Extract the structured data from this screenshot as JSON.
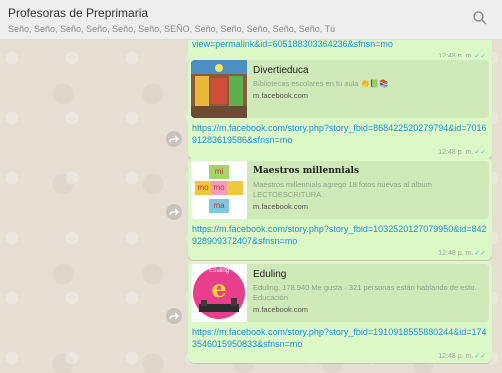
{
  "header": {
    "title": "Profesoras de Preprimaria",
    "members": "Seño, Seño, Seño, Seño, Seño, Seño, SEÑO, Seño, Seño, Seño, Seño, Seño, Tú"
  },
  "messages": [
    {
      "link": "view=permalink&id=605188303364236&sfnsn=mo",
      "time": "12:48 p. m."
    },
    {
      "preview_title": "Divertieduca",
      "preview_desc": "Bibliotecas escolares en tu aula 👏📗📚",
      "preview_domain": "m.facebook.com",
      "link": "https://m.facebook.com/story.php?story_fbid=868422520279794&id=701691283619586&sfnsn=mo",
      "time": "12:48 p. m."
    },
    {
      "preview_title": "Maestros millennials",
      "preview_desc": "Maestros millennials agregó 18 fotos nuevas al álbum LECTOESCRITURA.",
      "preview_domain": "m.facebook.com",
      "link": "https://m.facebook.com/story.php?story_fbid=1032520127079950&id=842928909372407&sfnsn=mo",
      "time": "12:48 p. m."
    },
    {
      "preview_title": "Eduling",
      "preview_desc": "Eduling. 178.940 Me gusta · 321 personas están hablando de esto. Educación",
      "preview_domain": "m.facebook.com",
      "link": "https://m.facebook.com/story.php?story_fbid=1910918555880244&id=1743546015950833&sfnsn=mo",
      "time": "12:48 p. m."
    }
  ],
  "thumbs": {
    "maestros_top": "mi",
    "maestros_mid": "mo",
    "maestros_bot": "ma",
    "maestros_side": "mo",
    "eduling_letter": "e",
    "eduling_word": "Eduling"
  },
  "colors": {
    "bubble": "#dcf8c6",
    "link": "#1a8fd4",
    "chat_bg": "#e6ded3"
  },
  "icons": {
    "search": "search-icon",
    "share": "share-icon",
    "tick": "double-check-icon"
  }
}
